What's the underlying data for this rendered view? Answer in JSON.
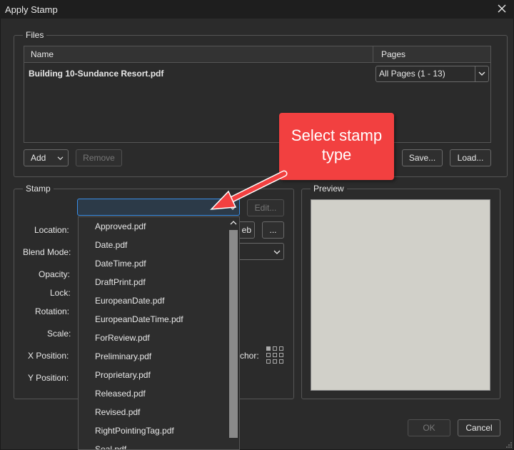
{
  "window": {
    "title": "Apply Stamp"
  },
  "files": {
    "legend": "Files",
    "columns": {
      "name": "Name",
      "pages": "Pages"
    },
    "rows": [
      {
        "name": "Building 10-Sundance Resort.pdf",
        "pages": "All Pages (1 - 13)"
      }
    ],
    "add_label": "Add",
    "remove_label": "Remove",
    "save_label": "Save...",
    "load_label": "Load..."
  },
  "stamp": {
    "legend": "Stamp",
    "type_value": "",
    "edit_label": "Edit...",
    "browse_label": "...",
    "location_partial": "eb",
    "anchor_partial": "chor:",
    "labels": {
      "location": "Location:",
      "blend_mode": "Blend Mode:",
      "opacity": "Opacity:",
      "lock": "Lock:",
      "rotation": "Rotation:",
      "scale": "Scale:",
      "x_position": "X Position:",
      "y_position": "Y Position:"
    }
  },
  "preview": {
    "legend": "Preview"
  },
  "dropdown": {
    "items": [
      "Approved.pdf",
      "Date.pdf",
      "DateTime.pdf",
      "DraftPrint.pdf",
      "EuropeanDate.pdf",
      "EuropeanDateTime.pdf",
      "ForReview.pdf",
      "Preliminary.pdf",
      "Proprietary.pdf",
      "Released.pdf",
      "Revised.pdf",
      "RightPointingTag.pdf",
      "Seal.pdf"
    ]
  },
  "callout": {
    "line1": "Select stamp",
    "line2": "type"
  },
  "footer": {
    "ok_label": "OK",
    "cancel_label": "Cancel"
  },
  "colors": {
    "accent": "#3a8ee6",
    "callout": "#f24040",
    "background": "#2b2b2b"
  }
}
